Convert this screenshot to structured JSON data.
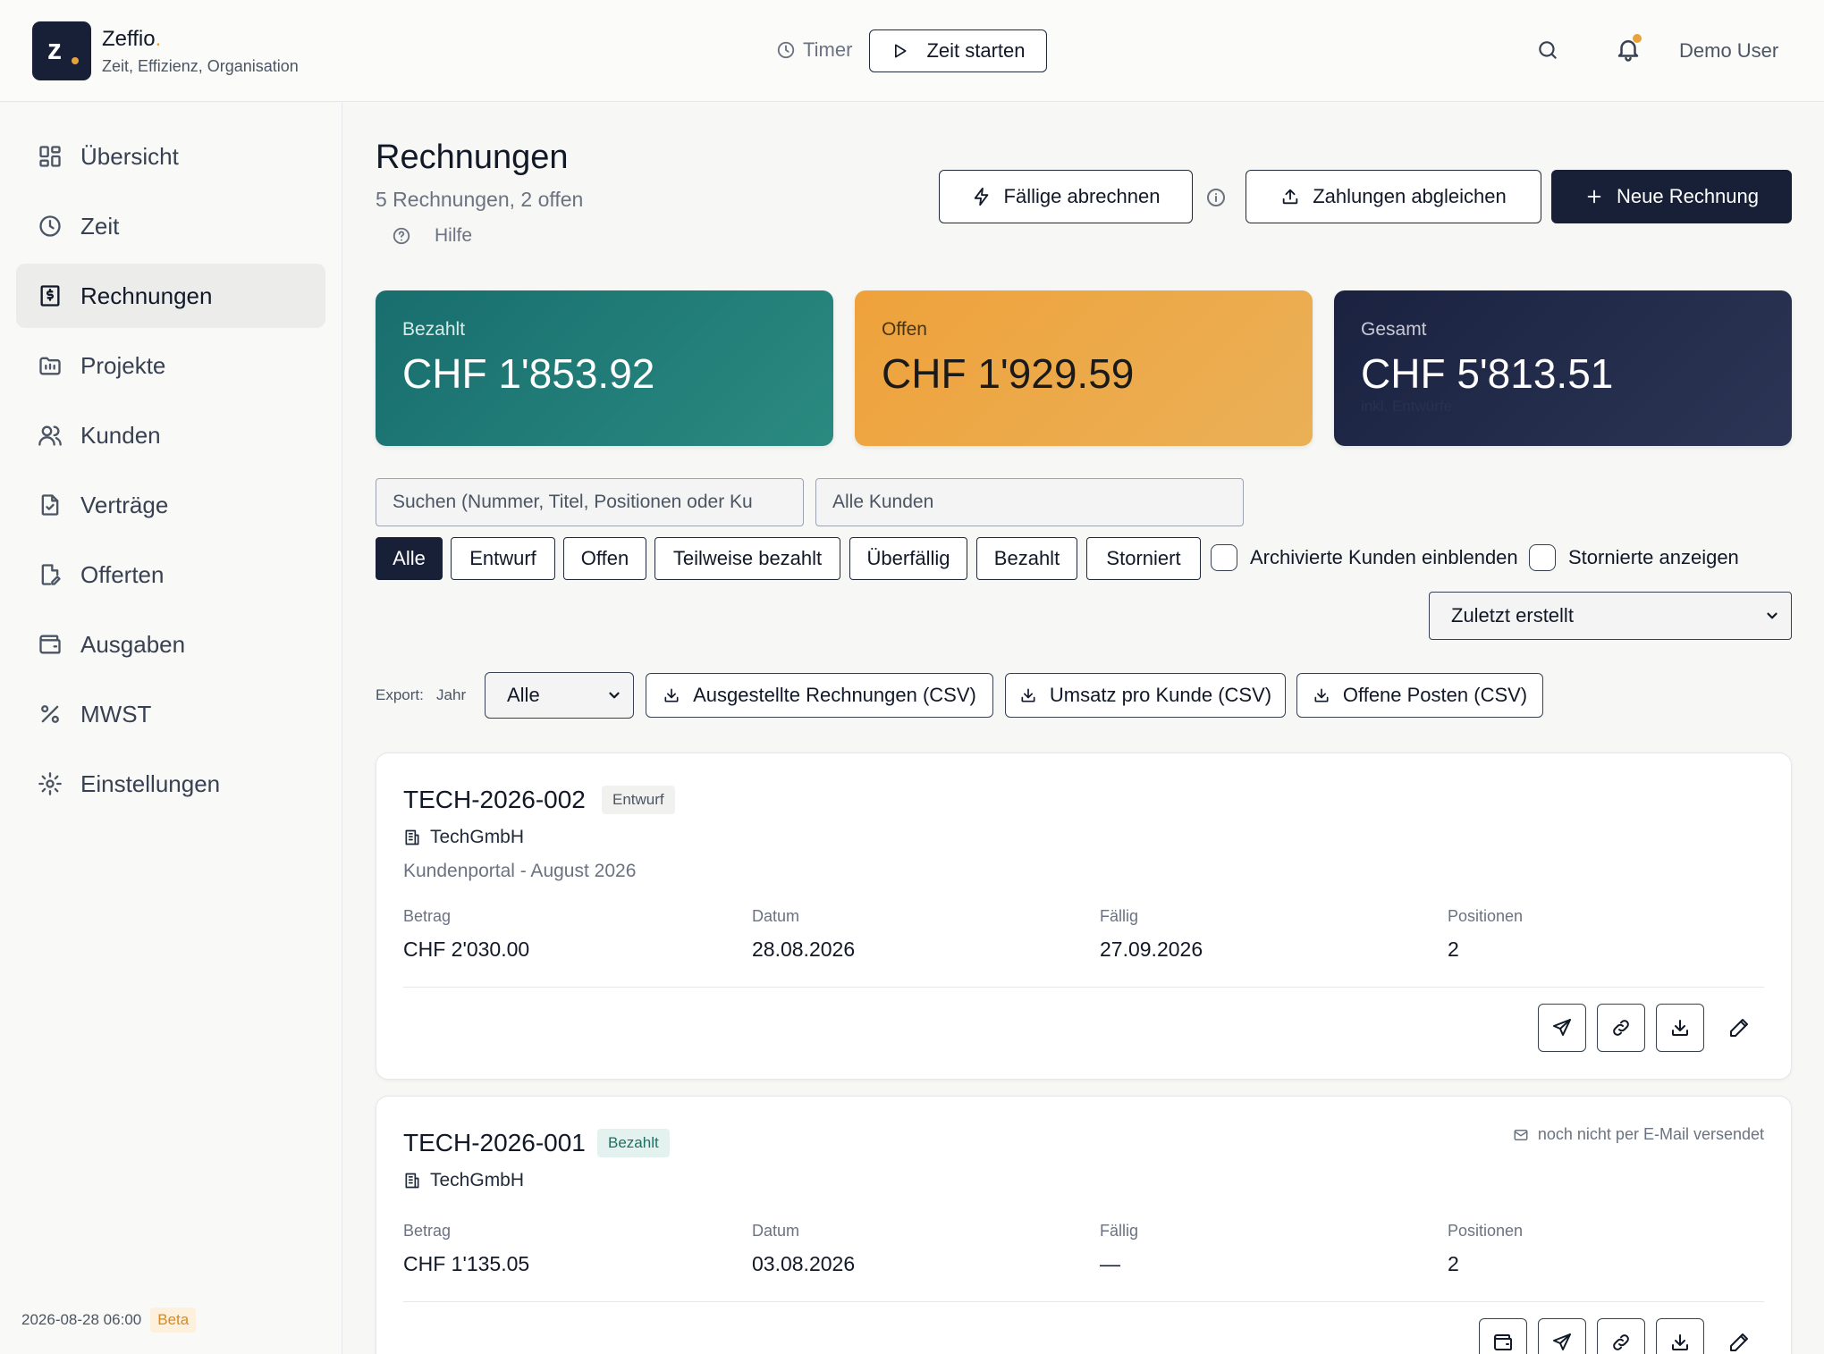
{
  "header": {
    "brand": "Zeffio",
    "brand_dot": ".",
    "logo_letter": "z",
    "tagline": "Zeit, Effizienz, Organisation",
    "timer_label": "Timer",
    "start_label": "Zeit starten",
    "user": "Demo User"
  },
  "sidebar": {
    "items": [
      {
        "label": "Übersicht",
        "icon": "dashboard-icon"
      },
      {
        "label": "Zeit",
        "icon": "clock-icon"
      },
      {
        "label": "Rechnungen",
        "icon": "invoice-icon",
        "active": true
      },
      {
        "label": "Projekte",
        "icon": "folder-icon"
      },
      {
        "label": "Kunden",
        "icon": "users-icon"
      },
      {
        "label": "Verträge",
        "icon": "contract-icon"
      },
      {
        "label": "Offerten",
        "icon": "quote-icon"
      },
      {
        "label": "Ausgaben",
        "icon": "wallet-icon"
      },
      {
        "label": "MWST",
        "icon": "percent-icon"
      },
      {
        "label": "Einstellungen",
        "icon": "gear-icon"
      }
    ],
    "timestamp": "2026-08-28 06:00",
    "beta": "Beta"
  },
  "main": {
    "title": "Rechnungen",
    "subtitle": "5 Rechnungen, 2 offen",
    "help": "Hilfe",
    "btn_due": "Fällige abrechnen",
    "btn_sync": "Zahlungen abgleichen",
    "btn_new": "Neue Rechnung",
    "stats": {
      "paid_label": "Bezahlt",
      "paid_value": "CHF 1'853.92",
      "open_label": "Offen",
      "open_value": "CHF 1'929.59",
      "total_label": "Gesamt",
      "total_value": "CHF 5'813.51",
      "total_note": "inkl. Entwürfe"
    },
    "search_placeholder": "Suchen (Nummer, Titel, Positionen oder Ku",
    "client_filter": "Alle Kunden",
    "filters": [
      "Alle",
      "Entwurf",
      "Offen",
      "Teilweise bezahlt",
      "Überfällig",
      "Bezahlt",
      "Storniert"
    ],
    "check_archived": "Archivierte Kunden einblenden",
    "check_cancelled": "Stornierte anzeigen",
    "sort": "Zuletzt erstellt",
    "export_label": "Export:",
    "year_label": "Jahr",
    "year_value": "Alle",
    "export_issued": "Ausgestellte Rechnungen (CSV)",
    "export_revenue": "Umsatz pro Kunde (CSV)",
    "export_open": "Offene Posten (CSV)"
  },
  "invoices": [
    {
      "number": "TECH-2026-002",
      "status": "Entwurf",
      "client": "TechGmbH",
      "title": "Kundenportal - August 2026",
      "lbl_amount": "Betrag",
      "amount": "CHF 2'030.00",
      "lbl_date": "Datum",
      "date": "28.08.2026",
      "lbl_due": "Fällig",
      "due": "27.09.2026",
      "lbl_items": "Positionen",
      "items": "2"
    },
    {
      "number": "TECH-2026-001",
      "status": "Bezahlt",
      "client": "TechGmbH",
      "mail_note": "noch nicht per E-Mail versendet",
      "lbl_amount": "Betrag",
      "amount": "CHF 1'135.05",
      "lbl_date": "Datum",
      "date": "03.08.2026",
      "lbl_due": "Fällig",
      "due": "—",
      "lbl_items": "Positionen",
      "items": "2"
    }
  ]
}
